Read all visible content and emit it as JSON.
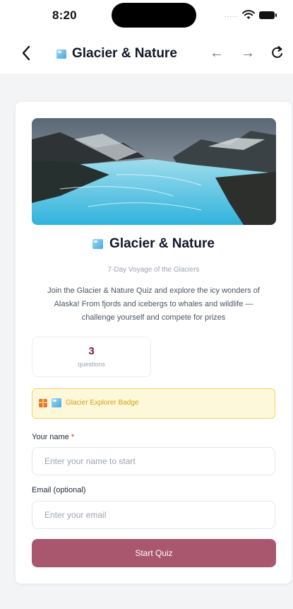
{
  "status_bar": {
    "time": "8:20",
    "signal_dots": "....."
  },
  "nav": {
    "title": "Glacier & Nature",
    "back_icon": "chevron-left-icon",
    "forward_icon": "arrow-right-icon",
    "backward_icon": "arrow-left-icon",
    "reload_icon": "reload-icon"
  },
  "card": {
    "title": "Glacier & Nature",
    "subtitle": "7-Day Voyage of the Glaciers",
    "description": "Join the Glacier & Nature Quiz and explore the icy wonders of Alaska! From fjords and icebergs to whales and wildlife — challenge yourself and compete for prizes",
    "stat": {
      "value": "3",
      "label": "questions"
    },
    "badge": {
      "text": "Glacier Explorer Badge",
      "icon": "gift-icon"
    },
    "form": {
      "name_label": "Your name",
      "name_required": "*",
      "name_placeholder": "Enter your name to start",
      "email_label": "Email (optional)",
      "email_placeholder": "Enter your email",
      "submit_label": "Start Quiz"
    }
  },
  "colors": {
    "accent": "#a9566f",
    "stat_number": "#7b1d3a",
    "badge_bg": "#fef8da",
    "badge_border": "#f4d35e",
    "badge_text": "#d1a319"
  }
}
